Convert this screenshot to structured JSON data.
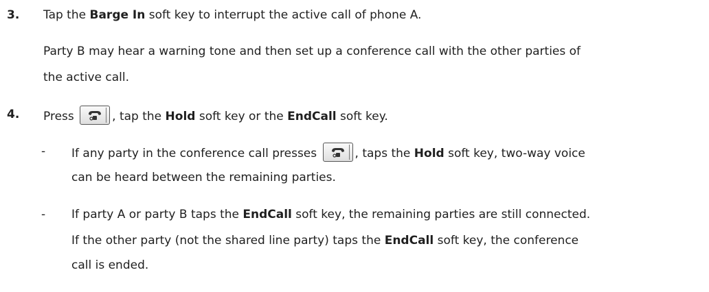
{
  "step3": {
    "number": "3.",
    "line_pre": "Tap the ",
    "line_bold": "Barge In",
    "line_post": " soft key to interrupt the active call of phone A.",
    "note_line1": "Party B may hear a warning tone and then set up a conference call with the other parties of",
    "note_line2": "the active call."
  },
  "step4": {
    "number": "4.",
    "press": "Press",
    "mid1": ", tap the ",
    "bold_hold": "Hold",
    "mid2": " soft key or the ",
    "bold_endcall": "EndCall",
    "post": " soft key.",
    "key_icon": "handset-icon"
  },
  "bullet1": {
    "dash": "-",
    "pre": "If any party in the conference call presses",
    "mid": ", taps the ",
    "bold": "Hold",
    "post": " soft key, two-way voice",
    "line2": "can be heard between the remaining parties."
  },
  "bullet2": {
    "dash": "-",
    "l1_pre": "If party A or party B taps the ",
    "l1_bold": "EndCall",
    "l1_post": " soft key, the remaining parties are still connected.",
    "l2_pre": "If the other party (not the shared line party) taps the ",
    "l2_bold": "EndCall",
    "l2_post": " soft key, the conference",
    "l3": "call is ended."
  }
}
